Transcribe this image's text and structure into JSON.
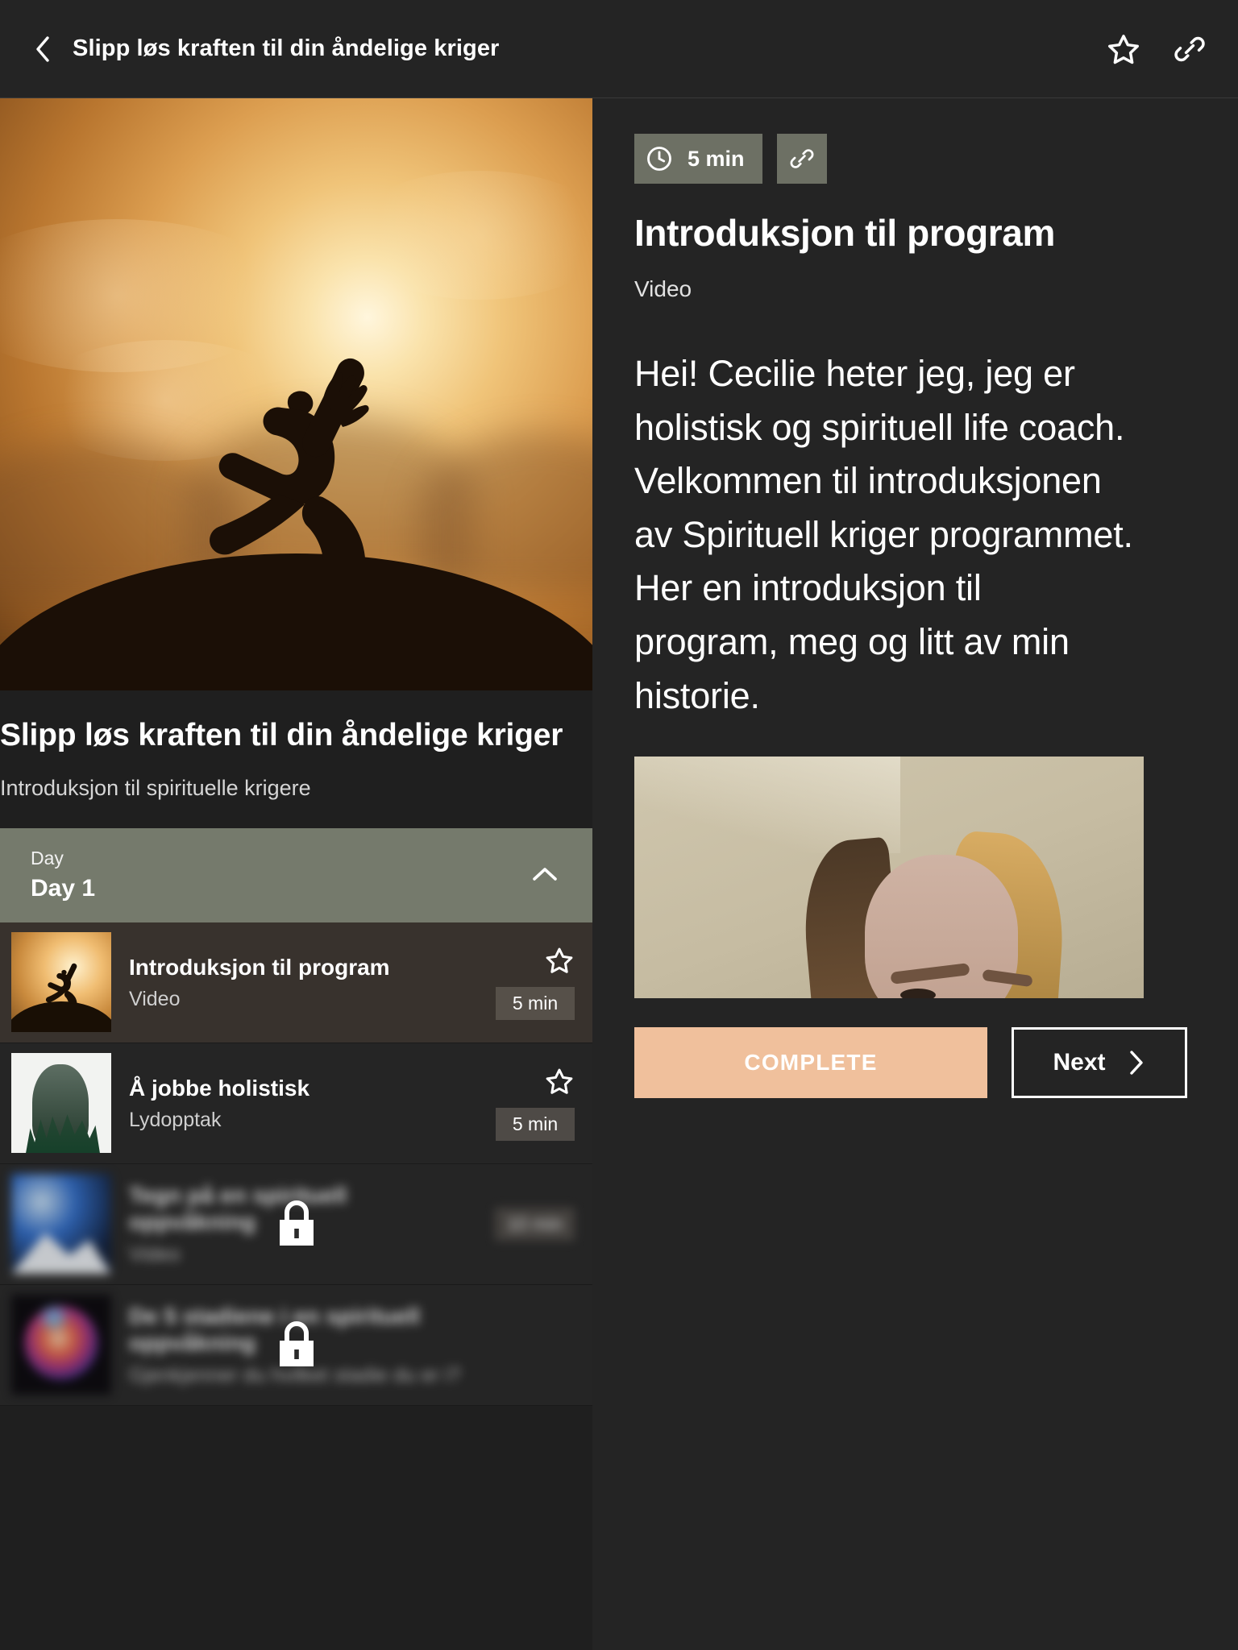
{
  "header": {
    "back_icon": "chevron-left-icon",
    "title": "Slipp løs kraften til din åndelige kriger",
    "favorite_icon": "star-icon",
    "share_icon": "link-icon"
  },
  "course": {
    "hero_image_alt": "person-yoga-sunset-silhouette",
    "title": "Slipp løs kraften til din åndelige kriger",
    "subtitle": "Introduksjon til spirituelle krigere"
  },
  "accordion": {
    "label": "Day",
    "value": "Day 1",
    "chevron_icon": "chevron-up-icon",
    "expanded": true
  },
  "lessons": [
    {
      "name": "Introduksjon til program",
      "type": "Video",
      "duration": "5 min",
      "star_icon": "star-icon",
      "locked": false,
      "active": true,
      "thumb": "sunset-yoga-thumb"
    },
    {
      "name": "Å jobbe holistisk",
      "type": "Lydopptak",
      "duration": "5 min",
      "star_icon": "star-icon",
      "locked": false,
      "active": false,
      "thumb": "forest-profile-thumb"
    },
    {
      "name": "Tegn på en spirituell oppvåkning",
      "type": "Video",
      "duration": "10 min",
      "star_icon": "star-icon",
      "locked": true,
      "active": false,
      "lock_icon": "lock-icon",
      "thumb": "blue-light-thumb"
    },
    {
      "name": "De 5 stadiene i en spirituell oppvåkning",
      "type": "Gjenkjenner du hvilket stadie du er i?",
      "duration": "",
      "star_icon": "star-icon",
      "locked": true,
      "active": false,
      "lock_icon": "lock-icon",
      "thumb": "nebula-thumb"
    }
  ],
  "detail": {
    "clock_icon": "clock-icon",
    "duration": "5 min",
    "link_icon": "link-icon",
    "title": "Introduksjon til program",
    "kind": "Video",
    "body": "Hei!\nCecilie heter jeg, jeg er holistisk og spirituell life coach. Velkommen til introduksjonen av Spirituell kriger programmet. Her en introduksjon til program, meg og litt av min historie.",
    "video_alt": "woman-face-video-frame",
    "complete_label": "COMPLETE",
    "next_label": "Next",
    "next_icon": "chevron-right-icon"
  },
  "colors": {
    "accent_olive": "#757a6c",
    "chip_olive": "#6d7064",
    "complete_peach": "#f0c09c",
    "page_bg": "#1f1f1f",
    "panel_bg": "#242424",
    "active_row": "#38322d"
  }
}
